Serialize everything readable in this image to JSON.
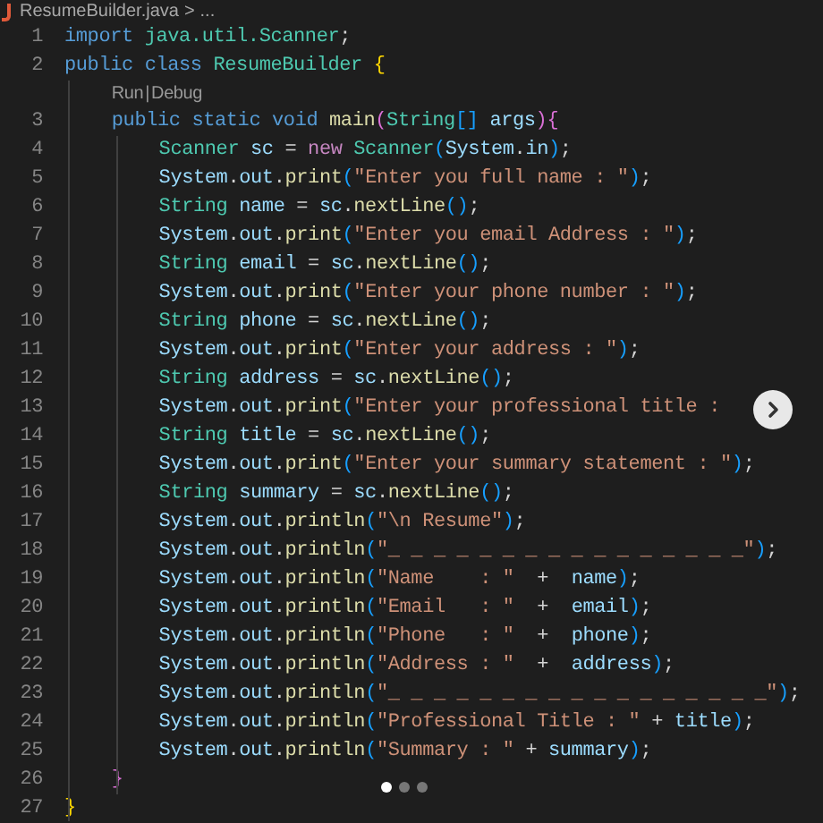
{
  "breadcrumb": {
    "file": "ResumeBuilder.java",
    "separator": ">",
    "more": "..."
  },
  "lines": [
    {
      "number": "1",
      "tokens": [
        {
          "kind": "kw",
          "text": "import "
        },
        {
          "kind": "type",
          "text": "java.util.Scanner"
        },
        {
          "kind": "p",
          "text": ";"
        }
      ]
    },
    {
      "number": "2",
      "tokens": [
        {
          "kind": "kw",
          "text": "public "
        },
        {
          "kind": "kw",
          "text": "class "
        },
        {
          "kind": "type",
          "text": "ResumeBuilder "
        },
        {
          "kind": "b1",
          "text": "{"
        }
      ],
      "codelens": {
        "run": "Run",
        "sep": "|",
        "debug": "Debug"
      },
      "children": [
        {
          "number": "3",
          "tokens": [
            {
              "kind": "kw",
              "text": "public "
            },
            {
              "kind": "kw",
              "text": "static "
            },
            {
              "kind": "kw",
              "text": "void "
            },
            {
              "kind": "fn",
              "text": "main"
            },
            {
              "kind": "b2",
              "text": "("
            },
            {
              "kind": "type",
              "text": "String"
            },
            {
              "kind": "b3",
              "text": "[] "
            },
            {
              "kind": "var",
              "text": "args"
            },
            {
              "kind": "b2",
              "text": "){"
            }
          ],
          "children": [
            {
              "number": "4",
              "tokens": [
                {
                  "kind": "type",
                  "text": "Scanner "
                },
                {
                  "kind": "var",
                  "text": "sc"
                },
                {
                  "kind": "p",
                  "text": " = "
                },
                {
                  "kind": "ctrl",
                  "text": "new "
                },
                {
                  "kind": "type",
                  "text": "Scanner"
                },
                {
                  "kind": "b3",
                  "text": "("
                },
                {
                  "kind": "var",
                  "text": "System"
                },
                {
                  "kind": "p",
                  "text": "."
                },
                {
                  "kind": "var",
                  "text": "in"
                },
                {
                  "kind": "b3",
                  "text": ")"
                },
                {
                  "kind": "p",
                  "text": ";"
                }
              ]
            },
            {
              "number": "5",
              "tokens": [
                {
                  "kind": "var",
                  "text": "System"
                },
                {
                  "kind": "p",
                  "text": "."
                },
                {
                  "kind": "var",
                  "text": "out"
                },
                {
                  "kind": "p",
                  "text": "."
                },
                {
                  "kind": "fn",
                  "text": "print"
                },
                {
                  "kind": "b3",
                  "text": "("
                },
                {
                  "kind": "str",
                  "text": "\"Enter you full name : \""
                },
                {
                  "kind": "b3",
                  "text": ")"
                },
                {
                  "kind": "p",
                  "text": ";"
                }
              ]
            },
            {
              "number": "6",
              "tokens": [
                {
                  "kind": "type",
                  "text": "String "
                },
                {
                  "kind": "var",
                  "text": "name"
                },
                {
                  "kind": "p",
                  "text": " = "
                },
                {
                  "kind": "var",
                  "text": "sc"
                },
                {
                  "kind": "p",
                  "text": "."
                },
                {
                  "kind": "fn",
                  "text": "nextLine"
                },
                {
                  "kind": "b3",
                  "text": "()"
                },
                {
                  "kind": "p",
                  "text": ";"
                }
              ]
            },
            {
              "number": "7",
              "tokens": [
                {
                  "kind": "var",
                  "text": "System"
                },
                {
                  "kind": "p",
                  "text": "."
                },
                {
                  "kind": "var",
                  "text": "out"
                },
                {
                  "kind": "p",
                  "text": "."
                },
                {
                  "kind": "fn",
                  "text": "print"
                },
                {
                  "kind": "b3",
                  "text": "("
                },
                {
                  "kind": "str",
                  "text": "\"Enter you email Address : \""
                },
                {
                  "kind": "b3",
                  "text": ")"
                },
                {
                  "kind": "p",
                  "text": ";"
                }
              ]
            },
            {
              "number": "8",
              "tokens": [
                {
                  "kind": "type",
                  "text": "String "
                },
                {
                  "kind": "var",
                  "text": "email"
                },
                {
                  "kind": "p",
                  "text": " = "
                },
                {
                  "kind": "var",
                  "text": "sc"
                },
                {
                  "kind": "p",
                  "text": "."
                },
                {
                  "kind": "fn",
                  "text": "nextLine"
                },
                {
                  "kind": "b3",
                  "text": "()"
                },
                {
                  "kind": "p",
                  "text": ";"
                }
              ]
            },
            {
              "number": "9",
              "tokens": [
                {
                  "kind": "var",
                  "text": "System"
                },
                {
                  "kind": "p",
                  "text": "."
                },
                {
                  "kind": "var",
                  "text": "out"
                },
                {
                  "kind": "p",
                  "text": "."
                },
                {
                  "kind": "fn",
                  "text": "print"
                },
                {
                  "kind": "b3",
                  "text": "("
                },
                {
                  "kind": "str",
                  "text": "\"Enter your phone number : \""
                },
                {
                  "kind": "b3",
                  "text": ")"
                },
                {
                  "kind": "p",
                  "text": ";"
                }
              ]
            },
            {
              "number": "10",
              "tokens": [
                {
                  "kind": "type",
                  "text": "String "
                },
                {
                  "kind": "var",
                  "text": "phone"
                },
                {
                  "kind": "p",
                  "text": " = "
                },
                {
                  "kind": "var",
                  "text": "sc"
                },
                {
                  "kind": "p",
                  "text": "."
                },
                {
                  "kind": "fn",
                  "text": "nextLine"
                },
                {
                  "kind": "b3",
                  "text": "()"
                },
                {
                  "kind": "p",
                  "text": ";"
                }
              ]
            },
            {
              "number": "11",
              "tokens": [
                {
                  "kind": "var",
                  "text": "System"
                },
                {
                  "kind": "p",
                  "text": "."
                },
                {
                  "kind": "var",
                  "text": "out"
                },
                {
                  "kind": "p",
                  "text": "."
                },
                {
                  "kind": "fn",
                  "text": "print"
                },
                {
                  "kind": "b3",
                  "text": "("
                },
                {
                  "kind": "str",
                  "text": "\"Enter your address : \""
                },
                {
                  "kind": "b3",
                  "text": ")"
                },
                {
                  "kind": "p",
                  "text": ";"
                }
              ]
            },
            {
              "number": "12",
              "tokens": [
                {
                  "kind": "type",
                  "text": "String "
                },
                {
                  "kind": "var",
                  "text": "address"
                },
                {
                  "kind": "p",
                  "text": " = "
                },
                {
                  "kind": "var",
                  "text": "sc"
                },
                {
                  "kind": "p",
                  "text": "."
                },
                {
                  "kind": "fn",
                  "text": "nextLine"
                },
                {
                  "kind": "b3",
                  "text": "()"
                },
                {
                  "kind": "p",
                  "text": ";"
                }
              ]
            },
            {
              "number": "13",
              "tokens": [
                {
                  "kind": "var",
                  "text": "System"
                },
                {
                  "kind": "p",
                  "text": "."
                },
                {
                  "kind": "var",
                  "text": "out"
                },
                {
                  "kind": "p",
                  "text": "."
                },
                {
                  "kind": "fn",
                  "text": "print"
                },
                {
                  "kind": "b3",
                  "text": "("
                },
                {
                  "kind": "str",
                  "text": "\"Enter your professional title :"
                }
              ]
            },
            {
              "number": "14",
              "tokens": [
                {
                  "kind": "type",
                  "text": "String "
                },
                {
                  "kind": "var",
                  "text": "title"
                },
                {
                  "kind": "p",
                  "text": " = "
                },
                {
                  "kind": "var",
                  "text": "sc"
                },
                {
                  "kind": "p",
                  "text": "."
                },
                {
                  "kind": "fn",
                  "text": "nextLine"
                },
                {
                  "kind": "b3",
                  "text": "()"
                },
                {
                  "kind": "p",
                  "text": ";"
                }
              ]
            },
            {
              "number": "15",
              "tokens": [
                {
                  "kind": "var",
                  "text": "System"
                },
                {
                  "kind": "p",
                  "text": "."
                },
                {
                  "kind": "var",
                  "text": "out"
                },
                {
                  "kind": "p",
                  "text": "."
                },
                {
                  "kind": "fn",
                  "text": "print"
                },
                {
                  "kind": "b3",
                  "text": "("
                },
                {
                  "kind": "str",
                  "text": "\"Enter your summary statement : \""
                },
                {
                  "kind": "b3",
                  "text": ")"
                },
                {
                  "kind": "p",
                  "text": ";"
                }
              ]
            },
            {
              "number": "16",
              "tokens": [
                {
                  "kind": "type",
                  "text": "String "
                },
                {
                  "kind": "var",
                  "text": "summary"
                },
                {
                  "kind": "p",
                  "text": " = "
                },
                {
                  "kind": "var",
                  "text": "sc"
                },
                {
                  "kind": "p",
                  "text": "."
                },
                {
                  "kind": "fn",
                  "text": "nextLine"
                },
                {
                  "kind": "b3",
                  "text": "()"
                },
                {
                  "kind": "p",
                  "text": ";"
                }
              ]
            },
            {
              "number": "17",
              "tokens": [
                {
                  "kind": "var",
                  "text": "System"
                },
                {
                  "kind": "p",
                  "text": "."
                },
                {
                  "kind": "var",
                  "text": "out"
                },
                {
                  "kind": "p",
                  "text": "."
                },
                {
                  "kind": "fn",
                  "text": "println"
                },
                {
                  "kind": "b3",
                  "text": "("
                },
                {
                  "kind": "str",
                  "text": "\"\\n Resume\""
                },
                {
                  "kind": "b3",
                  "text": ")"
                },
                {
                  "kind": "p",
                  "text": ";"
                }
              ]
            },
            {
              "number": "18",
              "tokens": [
                {
                  "kind": "var",
                  "text": "System"
                },
                {
                  "kind": "p",
                  "text": "."
                },
                {
                  "kind": "var",
                  "text": "out"
                },
                {
                  "kind": "p",
                  "text": "."
                },
                {
                  "kind": "fn",
                  "text": "println"
                },
                {
                  "kind": "b3",
                  "text": "("
                },
                {
                  "kind": "str",
                  "text": "\"_ _ _ _ _ _ _ _ _ _ _ _ _ _ _ _\""
                },
                {
                  "kind": "b3",
                  "text": ")"
                },
                {
                  "kind": "p",
                  "text": ";"
                }
              ]
            },
            {
              "number": "19",
              "tokens": [
                {
                  "kind": "var",
                  "text": "System"
                },
                {
                  "kind": "p",
                  "text": "."
                },
                {
                  "kind": "var",
                  "text": "out"
                },
                {
                  "kind": "p",
                  "text": "."
                },
                {
                  "kind": "fn",
                  "text": "println"
                },
                {
                  "kind": "b3",
                  "text": "("
                },
                {
                  "kind": "str",
                  "text": "\"Name    : \"  "
                },
                {
                  "kind": "p",
                  "text": "+  "
                },
                {
                  "kind": "var",
                  "text": "name"
                },
                {
                  "kind": "b3",
                  "text": ")"
                },
                {
                  "kind": "p",
                  "text": ";"
                }
              ]
            },
            {
              "number": "20",
              "tokens": [
                {
                  "kind": "var",
                  "text": "System"
                },
                {
                  "kind": "p",
                  "text": "."
                },
                {
                  "kind": "var",
                  "text": "out"
                },
                {
                  "kind": "p",
                  "text": "."
                },
                {
                  "kind": "fn",
                  "text": "println"
                },
                {
                  "kind": "b3",
                  "text": "("
                },
                {
                  "kind": "str",
                  "text": "\"Email   : \"  "
                },
                {
                  "kind": "p",
                  "text": "+  "
                },
                {
                  "kind": "var",
                  "text": "email"
                },
                {
                  "kind": "b3",
                  "text": ")"
                },
                {
                  "kind": "p",
                  "text": ";"
                }
              ]
            },
            {
              "number": "21",
              "tokens": [
                {
                  "kind": "var",
                  "text": "System"
                },
                {
                  "kind": "p",
                  "text": "."
                },
                {
                  "kind": "var",
                  "text": "out"
                },
                {
                  "kind": "p",
                  "text": "."
                },
                {
                  "kind": "fn",
                  "text": "println"
                },
                {
                  "kind": "b3",
                  "text": "("
                },
                {
                  "kind": "str",
                  "text": "\"Phone   : \"  "
                },
                {
                  "kind": "p",
                  "text": "+  "
                },
                {
                  "kind": "var",
                  "text": "phone"
                },
                {
                  "kind": "b3",
                  "text": ")"
                },
                {
                  "kind": "p",
                  "text": ";"
                }
              ]
            },
            {
              "number": "22",
              "tokens": [
                {
                  "kind": "var",
                  "text": "System"
                },
                {
                  "kind": "p",
                  "text": "."
                },
                {
                  "kind": "var",
                  "text": "out"
                },
                {
                  "kind": "p",
                  "text": "."
                },
                {
                  "kind": "fn",
                  "text": "println"
                },
                {
                  "kind": "b3",
                  "text": "("
                },
                {
                  "kind": "str",
                  "text": "\"Address : \"  "
                },
                {
                  "kind": "p",
                  "text": "+  "
                },
                {
                  "kind": "var",
                  "text": "address"
                },
                {
                  "kind": "b3",
                  "text": ")"
                },
                {
                  "kind": "p",
                  "text": ";"
                }
              ]
            },
            {
              "number": "23",
              "tokens": [
                {
                  "kind": "var",
                  "text": "System"
                },
                {
                  "kind": "p",
                  "text": "."
                },
                {
                  "kind": "var",
                  "text": "out"
                },
                {
                  "kind": "p",
                  "text": "."
                },
                {
                  "kind": "fn",
                  "text": "println"
                },
                {
                  "kind": "b3",
                  "text": "("
                },
                {
                  "kind": "str",
                  "text": "\"_ _ _ _ _ _ _ _ _ _ _ _ _ _ _ _ _\""
                },
                {
                  "kind": "b3",
                  "text": ")"
                },
                {
                  "kind": "p",
                  "text": ";"
                }
              ]
            },
            {
              "number": "24",
              "tokens": [
                {
                  "kind": "var",
                  "text": "System"
                },
                {
                  "kind": "p",
                  "text": "."
                },
                {
                  "kind": "var",
                  "text": "out"
                },
                {
                  "kind": "p",
                  "text": "."
                },
                {
                  "kind": "fn",
                  "text": "println"
                },
                {
                  "kind": "b3",
                  "text": "("
                },
                {
                  "kind": "str",
                  "text": "\"Professional Title : \" "
                },
                {
                  "kind": "p",
                  "text": "+ "
                },
                {
                  "kind": "var",
                  "text": "title"
                },
                {
                  "kind": "b3",
                  "text": ")"
                },
                {
                  "kind": "p",
                  "text": ";"
                }
              ]
            },
            {
              "number": "25",
              "tokens": [
                {
                  "kind": "var",
                  "text": "System"
                },
                {
                  "kind": "p",
                  "text": "."
                },
                {
                  "kind": "var",
                  "text": "out"
                },
                {
                  "kind": "p",
                  "text": "."
                },
                {
                  "kind": "fn",
                  "text": "println"
                },
                {
                  "kind": "b3",
                  "text": "("
                },
                {
                  "kind": "str",
                  "text": "\"Summary : \" "
                },
                {
                  "kind": "p",
                  "text": "+ "
                },
                {
                  "kind": "var",
                  "text": "summary"
                },
                {
                  "kind": "b3",
                  "text": ")"
                },
                {
                  "kind": "p",
                  "text": ";"
                }
              ]
            }
          ]
        },
        {
          "number": "26",
          "tokens": [
            {
              "kind": "b2",
              "text": "}"
            }
          ]
        }
      ]
    },
    {
      "number": "27",
      "tokens": [
        {
          "kind": "b1",
          "text": "}"
        }
      ]
    }
  ],
  "pager": [
    {
      "selected": true
    },
    {
      "selected": false
    },
    {
      "selected": false
    }
  ]
}
